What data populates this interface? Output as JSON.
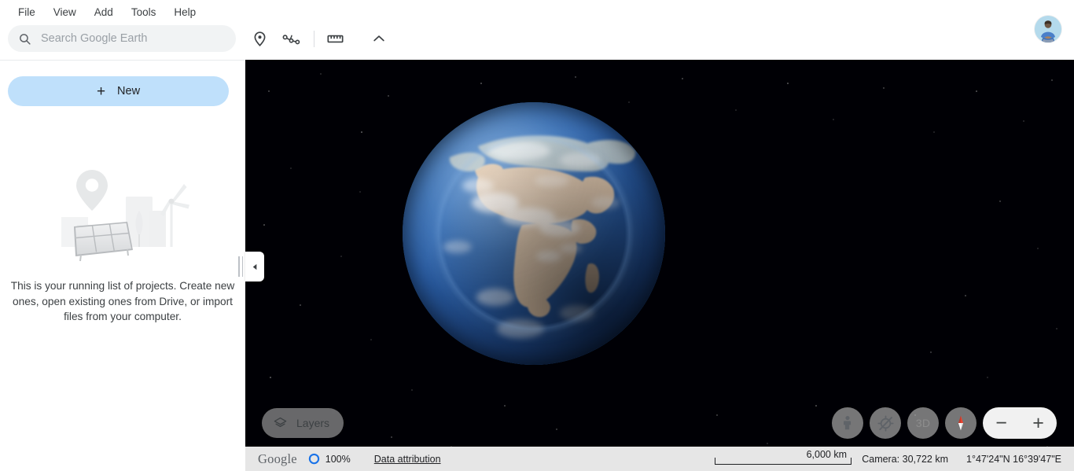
{
  "menubar": {
    "items": [
      {
        "label": "File",
        "name": "menu-file"
      },
      {
        "label": "View",
        "name": "menu-view"
      },
      {
        "label": "Add",
        "name": "menu-add"
      },
      {
        "label": "Tools",
        "name": "menu-tools"
      },
      {
        "label": "Help",
        "name": "menu-help"
      }
    ]
  },
  "search": {
    "placeholder": "Search Google Earth",
    "value": "",
    "icon": "search-icon"
  },
  "toolbar": {
    "icons": [
      {
        "name": "map-pin-icon",
        "title": "Add placemark"
      },
      {
        "name": "path-icon",
        "title": "Add path"
      },
      {
        "name": "ruler-icon",
        "title": "Measure distance"
      },
      {
        "name": "chevron-up-icon",
        "title": "Collapse toolbar"
      }
    ]
  },
  "account": {
    "avatar_name": "avatar",
    "avatar_bg": "#b3d9ec"
  },
  "sidebar": {
    "new_button": {
      "label": "New",
      "plus": "+",
      "color": "#bfe0fb"
    },
    "empty_state": {
      "illustration": "projects-empty-illustration",
      "text": "This is your running list of projects. Create new ones, open existing ones from Drive, or import files from your computer."
    },
    "collapse": {
      "name": "collapse-sidebar-button",
      "icon": "chevron-left-icon"
    }
  },
  "map": {
    "globe": {
      "name": "earth-globe",
      "features": "Africa, Europe, Middle East"
    },
    "layers_button": {
      "label": "Layers",
      "icon": "layers-icon"
    },
    "controls": [
      {
        "name": "street-view-pegman-button",
        "icon": "pegman-icon",
        "label": ""
      },
      {
        "name": "location-off-button",
        "icon": "location-off-icon",
        "label": ""
      },
      {
        "name": "toggle-3d-button",
        "icon": "3d-icon",
        "label": "3D"
      },
      {
        "name": "compass-button",
        "icon": "compass-icon",
        "label": ""
      }
    ],
    "zoom": {
      "out_label": "−",
      "in_label": "+",
      "out_name": "zoom-out-button",
      "in_name": "zoom-in-button"
    }
  },
  "statusbar": {
    "brand": "Google",
    "progress_percent": "100%",
    "progress_color": "#1a73e8",
    "attribution_label": "Data attribution",
    "scale_label": "6,000 km",
    "camera": "Camera: 30,722 km",
    "coordinates": "1°47'24\"N 16°39'47\"E"
  }
}
